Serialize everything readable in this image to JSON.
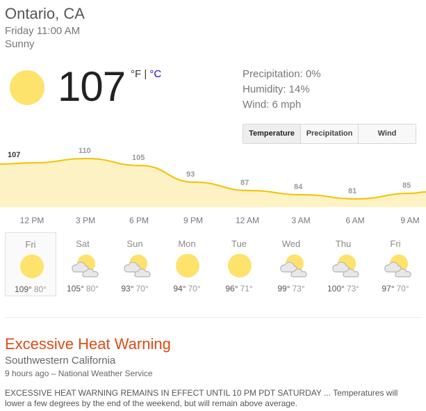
{
  "location": "Ontario, CA",
  "datetime": "Friday 11:00 AM",
  "condition": "Sunny",
  "current": {
    "temperature": "107",
    "unit_f": "°F",
    "unit_sep": " | ",
    "unit_c": "°C",
    "icon": "sun-icon"
  },
  "details": {
    "precipitation": "Precipitation: 0%",
    "humidity": "Humidity: 14%",
    "wind": "Wind: 6 mph"
  },
  "tabs": [
    {
      "label": "Temperature",
      "active": true
    },
    {
      "label": "Precipitation",
      "active": false
    },
    {
      "label": "Wind",
      "active": false
    }
  ],
  "chart_data": {
    "type": "area",
    "x": [
      "12 PM",
      "3 PM",
      "6 PM",
      "9 PM",
      "12 AM",
      "3 AM",
      "6 AM",
      "9 AM"
    ],
    "values": [
      107,
      110,
      105,
      93,
      87,
      84,
      81,
      85
    ],
    "labels": [
      "107",
      "110",
      "105",
      "93",
      "87",
      "84",
      "81",
      "85"
    ],
    "title": "",
    "xlabel": "",
    "ylabel": "",
    "grid": false,
    "colors": {
      "fill": "#fdf2c4",
      "line": "#f6c000"
    }
  },
  "forecast": [
    {
      "day": "Fri",
      "high": "109°",
      "low": "80°",
      "icon": "sun-icon",
      "selected": true
    },
    {
      "day": "Sat",
      "high": "105°",
      "low": "80°",
      "icon": "partly-cloudy-icon",
      "selected": false
    },
    {
      "day": "Sun",
      "high": "93°",
      "low": "70°",
      "icon": "partly-cloudy-icon",
      "selected": false
    },
    {
      "day": "Mon",
      "high": "94°",
      "low": "70°",
      "icon": "sun-icon",
      "selected": false
    },
    {
      "day": "Tue",
      "high": "96°",
      "low": "71°",
      "icon": "sun-icon",
      "selected": false
    },
    {
      "day": "Wed",
      "high": "99°",
      "low": "73°",
      "icon": "partly-cloudy-icon",
      "selected": false
    },
    {
      "day": "Thu",
      "high": "100°",
      "low": "73°",
      "icon": "partly-cloudy-icon",
      "selected": false
    },
    {
      "day": "Fri",
      "high": "97°",
      "low": "70°",
      "icon": "partly-cloudy-icon",
      "selected": false
    }
  ],
  "alert": {
    "title": "Excessive Heat Warning",
    "region": "Southwestern California",
    "meta": "9 hours ago – National Weather Service",
    "text": "EXCESSIVE HEAT WARNING REMAINS IN EFFECT UNTIL 10 PM PDT SATURDAY ... Temperatures will lower a few degrees by the end of the weekend, but will remain above average.",
    "color": "#dd4b13"
  }
}
